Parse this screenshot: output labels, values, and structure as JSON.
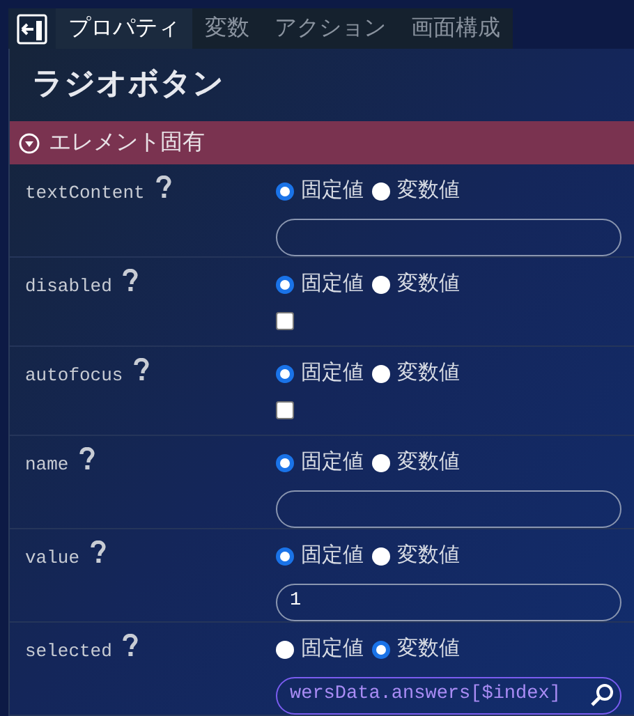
{
  "tabs": [
    {
      "label": "プロパティ",
      "selected": true
    },
    {
      "label": "変数",
      "selected": false
    },
    {
      "label": "アクション",
      "selected": false
    },
    {
      "label": "画面構成",
      "selected": false
    }
  ],
  "title": "ラジオボタン",
  "section": {
    "label": "エレメント固有",
    "expanded": true
  },
  "properties": [
    {
      "name": "textContent",
      "kind": "text",
      "options": [
        {
          "label": "固定値",
          "selected": true
        },
        {
          "label": "変数値",
          "selected": false
        }
      ]
    },
    {
      "name": "disabled",
      "kind": "checkbox",
      "checked": false,
      "options": [
        {
          "label": "固定値",
          "selected": true
        },
        {
          "label": "変数値",
          "selected": false
        }
      ]
    },
    {
      "name": "autofocus",
      "kind": "checkbox",
      "checked": false,
      "options": [
        {
          "label": "固定値",
          "selected": true
        },
        {
          "label": "変数値",
          "selected": false
        }
      ]
    },
    {
      "name": "name",
      "kind": "text",
      "options": [
        {
          "label": "固定値",
          "selected": true
        },
        {
          "label": "変数値",
          "selected": false
        }
      ]
    },
    {
      "name": "value",
      "kind": "text",
      "value": "1",
      "options": [
        {
          "label": "固定値",
          "selected": true
        },
        {
          "label": "変数値",
          "selected": false
        }
      ]
    },
    {
      "name": "selected",
      "kind": "variable",
      "value": "wersData.answers[$index]",
      "options": [
        {
          "label": "固定値",
          "selected": false
        },
        {
          "label": "変数値",
          "selected": true
        }
      ]
    }
  ]
}
